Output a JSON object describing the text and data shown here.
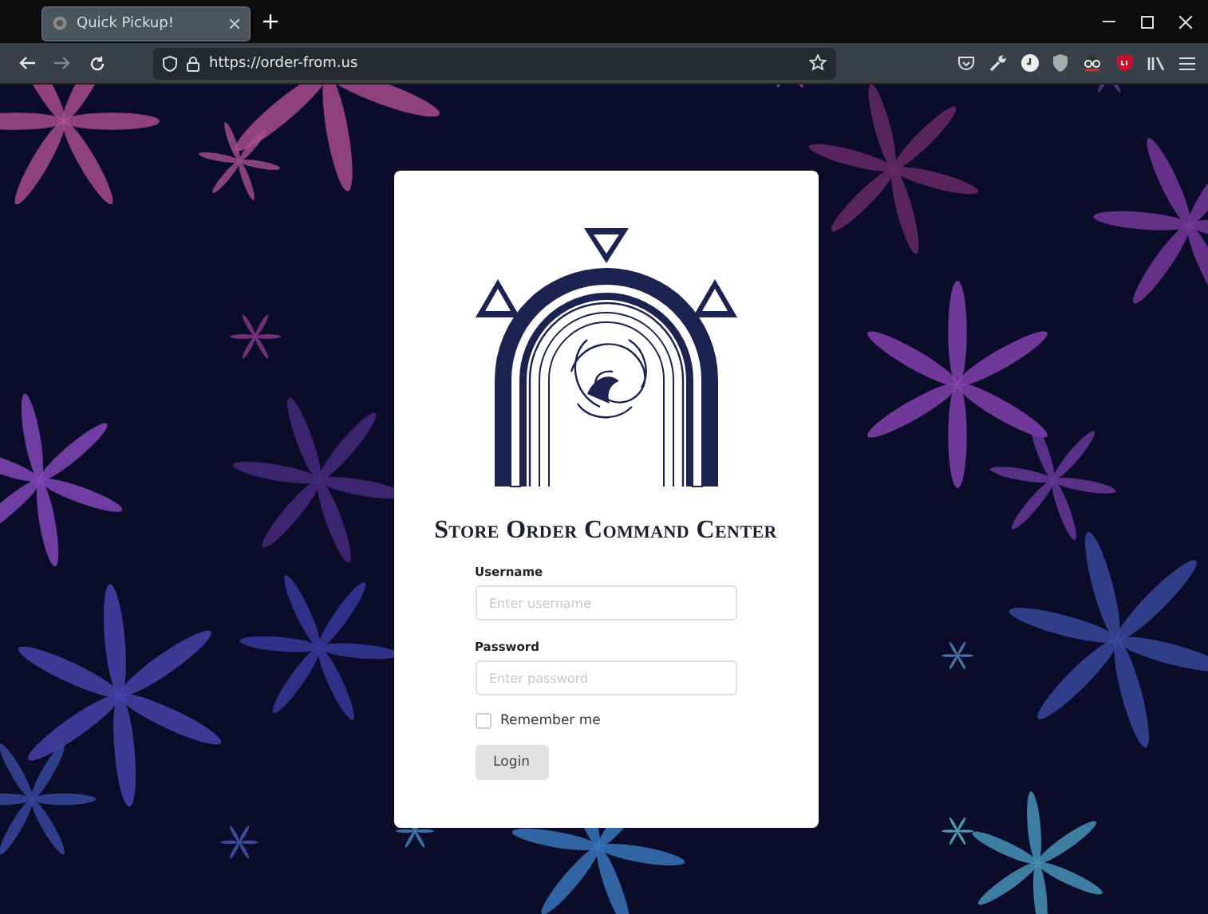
{
  "browser": {
    "tabs": [
      {
        "title": "Quick Pickup!",
        "selected": true
      }
    ],
    "address": "https://order-from.us"
  },
  "login": {
    "title": "Store Order Command Center",
    "fields": [
      {
        "label": "Username",
        "placeholder": "Enter username"
      },
      {
        "label": "Password",
        "placeholder": "Enter password"
      }
    ],
    "remember": {
      "label": "Remember me",
      "checked": false
    },
    "button": "Login"
  }
}
